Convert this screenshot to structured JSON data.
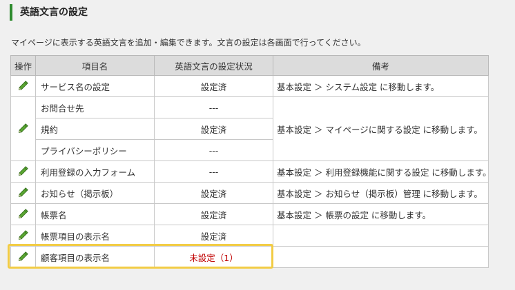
{
  "header": {
    "title": "英語文言の設定"
  },
  "description": "マイページに表示する英語文言を追加・編集できます。文言の設定は各画面で行ってください。",
  "table": {
    "columns": [
      "操作",
      "項目名",
      "英語文言の設定状況",
      "備考"
    ],
    "rows": [
      {
        "name": "サービス名の設定",
        "status": "設定済",
        "remarks": "基本設定 ＞ システム設定 に移動します。"
      },
      {
        "name": "お問合せ先",
        "status": "---",
        "remarks": "基本設定 ＞ マイページに関する設定 に移動します。"
      },
      {
        "name": "規約",
        "status": "設定済"
      },
      {
        "name": "プライバシーポリシー",
        "status": "---"
      },
      {
        "name": "利用登録の入力フォーム",
        "status": "---",
        "remarks": "基本設定 ＞ 利用登録機能に関する設定 に移動します。"
      },
      {
        "name": "お知らせ（掲示板）",
        "status": "設定済",
        "remarks": "基本設定 ＞ お知らせ（掲示板）管理 に移動します。"
      },
      {
        "name": "帳票名",
        "status": "設定済",
        "remarks": "基本設定 ＞ 帳票の設定 に移動します。"
      },
      {
        "name": "帳票項目の表示名",
        "status": "設定済",
        "remarks": ""
      },
      {
        "name": "顧客項目の表示名",
        "status": "未設定（1）",
        "remarks": ""
      }
    ]
  },
  "colors": {
    "accent": "#2e8b2e",
    "unset": "#c00000",
    "highlight": "#f2cc44",
    "pencil": "#5aa532"
  },
  "icons": {
    "edit": "pencil-icon"
  }
}
